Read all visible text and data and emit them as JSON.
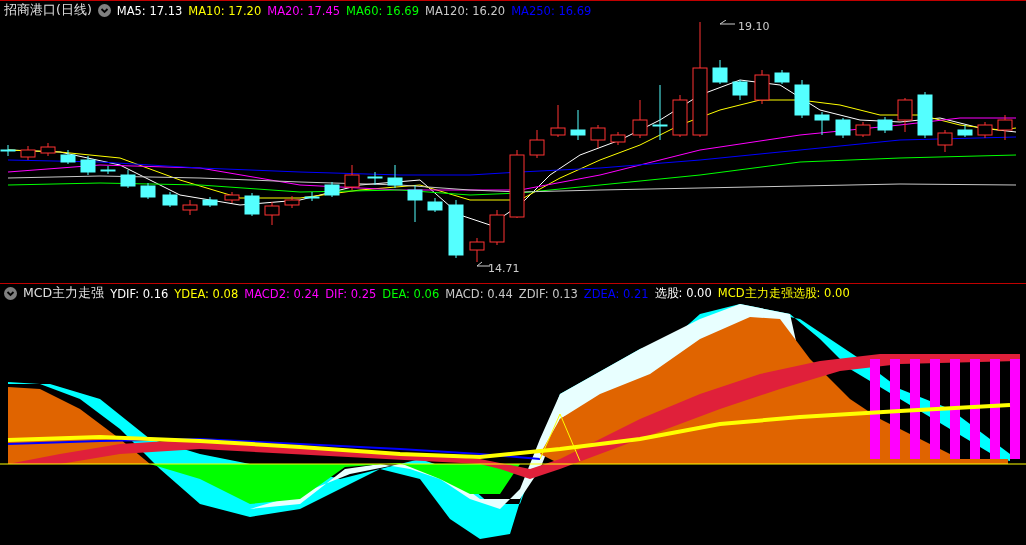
{
  "price_panel": {
    "title": "招商港口(日线)",
    "legend": [
      {
        "label": "MA5: 17.13",
        "color": "#ffffff"
      },
      {
        "label": "MA10: 17.20",
        "color": "#ffff00"
      },
      {
        "label": "MA20: 17.45",
        "color": "#ff00ff"
      },
      {
        "label": "MA60: 16.69",
        "color": "#00ff00"
      },
      {
        "label": "MA120: 16.20",
        "color": "#c8c8c8"
      },
      {
        "label": "MA250: 16.69",
        "color": "#0000ff"
      }
    ],
    "high_label": "19.10",
    "low_label": "14.71"
  },
  "indicator_panel": {
    "title": "MCD主力走强",
    "legend": [
      {
        "label": "YDIF: 0.16",
        "color": "#ffffff"
      },
      {
        "label": "YDEA: 0.08",
        "color": "#ffff00"
      },
      {
        "label": "MACD2: 0.24",
        "color": "#ff00ff"
      },
      {
        "label": "DIF: 0.25",
        "color": "#ff00ff"
      },
      {
        "label": "DEA: 0.06",
        "color": "#00ff00"
      },
      {
        "label": "MACD: 0.44",
        "color": "#c8c8c8"
      },
      {
        "label": "ZDIF: 0.13",
        "color": "#c8c8c8"
      },
      {
        "label": "ZDEA: 0.21",
        "color": "#0000ff"
      },
      {
        "label": "选股: 0.00",
        "color": "#ffffff"
      },
      {
        "label": "MCD主力走强选股: 0.00",
        "color": "#ffff00"
      }
    ]
  }
}
